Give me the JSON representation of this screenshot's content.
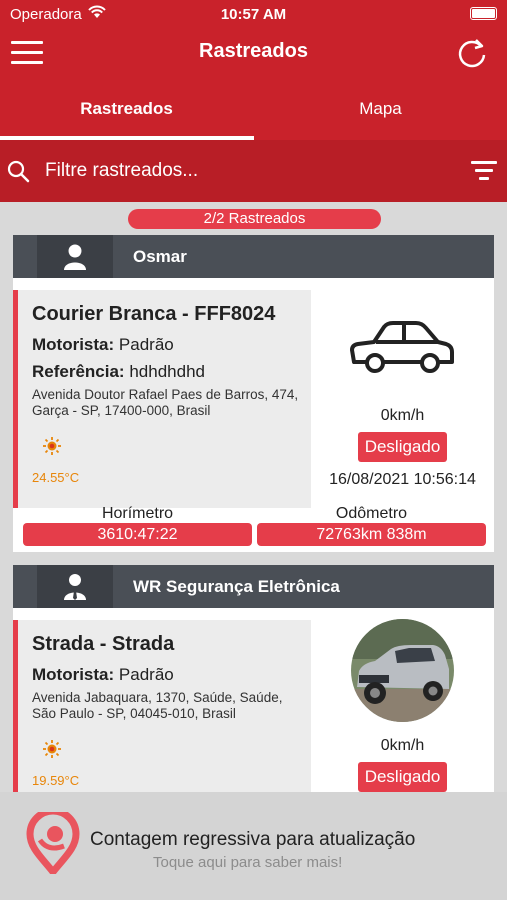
{
  "status_bar": {
    "carrier": "Operadora",
    "time": "10:57 AM"
  },
  "header": {
    "title": "Rastreados",
    "menu_icon": "hamburger-icon",
    "refresh_icon": "refresh-icon"
  },
  "tabs": [
    {
      "label": "Rastreados",
      "active": true
    },
    {
      "label": "Mapa",
      "active": false
    }
  ],
  "search": {
    "placeholder": "Filtre rastreados...",
    "value": ""
  },
  "count_label": "2/2 Rastreados",
  "groups": [
    {
      "name": "Osmar",
      "icon": "person-icon",
      "vehicle": {
        "title": "Courier Branca - FFF8024",
        "driver_label": "Motorista:",
        "driver": "Padrão",
        "reference_label": "Referência:",
        "reference": "hdhdhdhd",
        "address": "Avenida Doutor Rafael Paes de Barros, 474, Garça - SP, 17400-000, Brasil",
        "temperature": "24.55°C",
        "speed": "0km/h",
        "status": "Desligado",
        "datetime": "16/08/2021 10:56:14",
        "hourmeter_label": "Horímetro",
        "hourmeter": "3610:47:22",
        "odometer_label": "Odômetro",
        "odometer": "72763km 838m",
        "image": "car-outline-icon"
      }
    },
    {
      "name": "WR Segurança Eletrônica",
      "icon": "business-person-icon",
      "vehicle": {
        "title": "Strada - Strada",
        "driver_label": "Motorista:",
        "driver": "Padrão",
        "address": "Avenida Jabaquara, 1370, Saúde, Saúde, São Paulo - SP, 04045-010, Brasil",
        "temperature": "19.59°C",
        "speed": "0km/h",
        "status": "Desligado",
        "image": "car-photo"
      }
    }
  ],
  "banner": {
    "title": "Contagem regressiva para atualização",
    "subtitle": "Toque aqui para saber mais!"
  },
  "colors": {
    "primary": "#c9222b",
    "accent": "#e53d4a",
    "group_header": "#4a4f56",
    "temperature": "#e8860a"
  }
}
